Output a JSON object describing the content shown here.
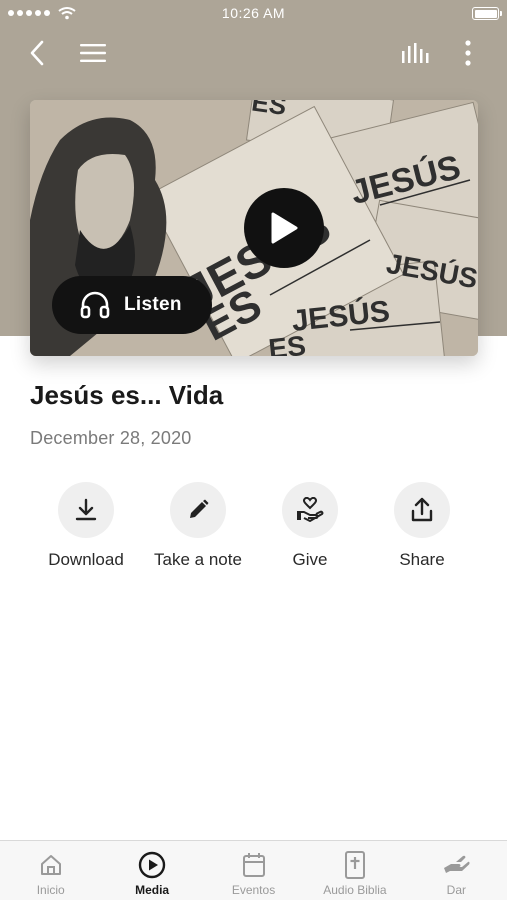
{
  "status_bar": {
    "time": "10:26 AM"
  },
  "nav": {
    "back_icon": "chevron-left-icon",
    "menu_icon": "hamburger-icon",
    "audio_icon": "equalizer-icon",
    "more_icon": "more-vertical-icon"
  },
  "media": {
    "artwork_text": [
      "JESÚS",
      "ES"
    ],
    "listen_label": "Listen",
    "title": "Jesús es... Vida",
    "date": "December 28, 2020"
  },
  "actions": [
    {
      "label": "Download",
      "icon": "download-icon"
    },
    {
      "label": "Take a note",
      "icon": "pencil-icon"
    },
    {
      "label": "Give",
      "icon": "give-hand-heart-icon"
    },
    {
      "label": "Share",
      "icon": "share-icon"
    }
  ],
  "tabs": [
    {
      "label": "Inicio",
      "icon": "home-icon",
      "active": false
    },
    {
      "label": "Media",
      "icon": "play-circle-icon",
      "active": true
    },
    {
      "label": "Eventos",
      "icon": "calendar-icon",
      "active": false
    },
    {
      "label": "Audio Biblia",
      "icon": "bible-icon",
      "active": false
    },
    {
      "label": "Dar",
      "icon": "hand-icon",
      "active": false
    }
  ],
  "colors": {
    "header_bg": "#ada597",
    "accent": "#111111",
    "muted_text": "#7a7a7a"
  }
}
